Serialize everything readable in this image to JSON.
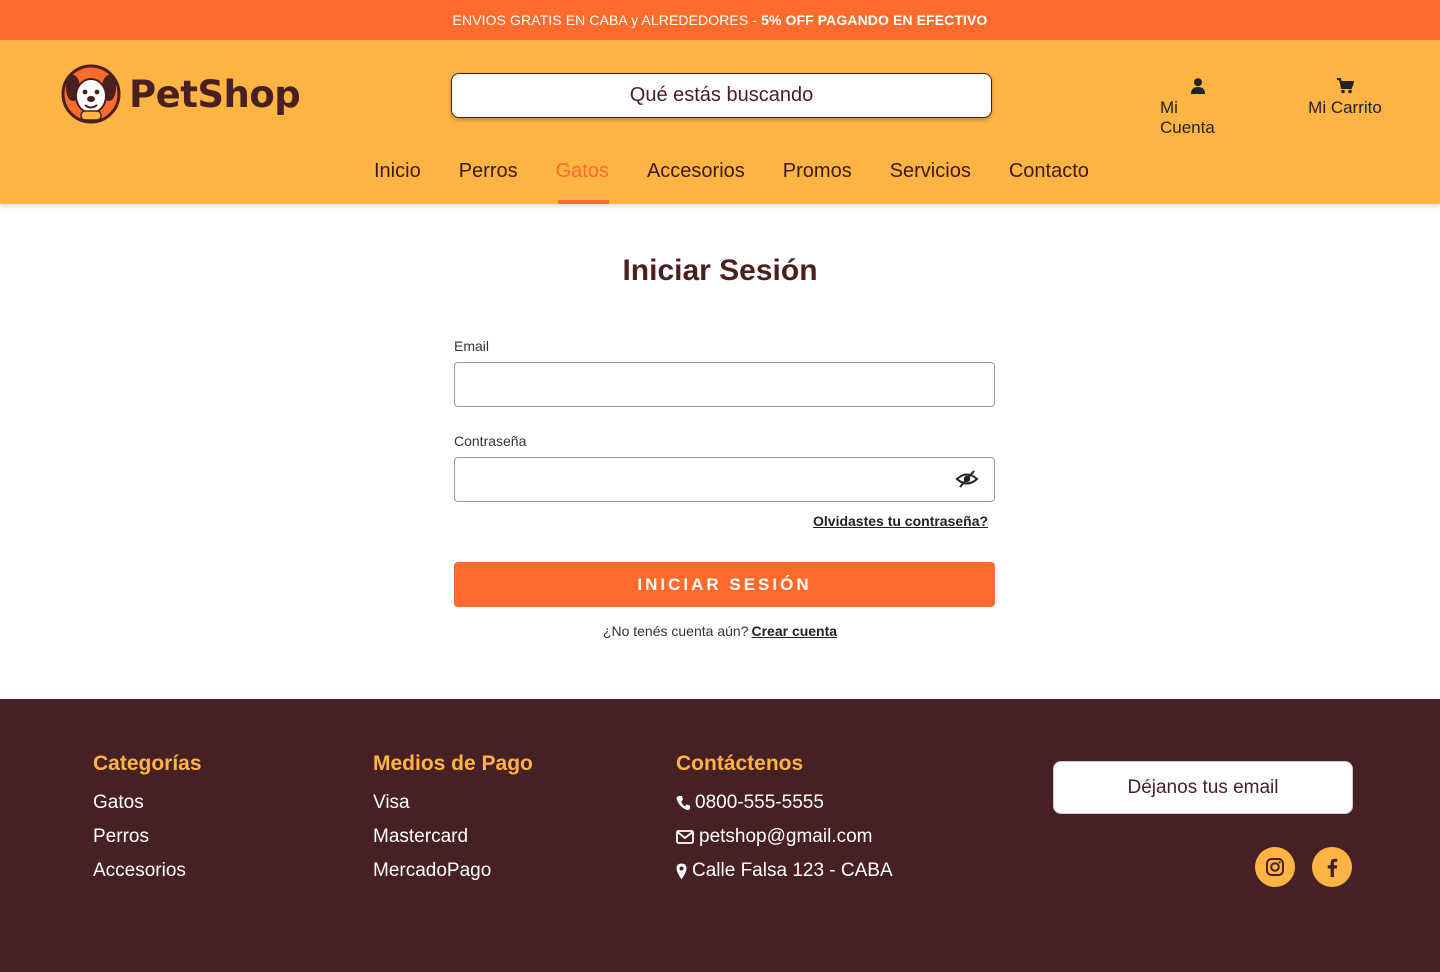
{
  "promo": {
    "text": "ENVIOS GRATIS EN CABA y ALREDEDORES -",
    "highlight": "5% OFF PAGANDO EN EFECTIVO"
  },
  "header": {
    "logo_text": "PetShop",
    "search_placeholder": "Qué estás buscando",
    "account_label": "Mi Cuenta",
    "cart_label": "Mi Carrito"
  },
  "nav": {
    "items": [
      {
        "label": "Inicio"
      },
      {
        "label": "Perros"
      },
      {
        "label": "Gatos",
        "active": true
      },
      {
        "label": "Accesorios"
      },
      {
        "label": "Promos"
      },
      {
        "label": "Servicios"
      },
      {
        "label": "Contacto"
      }
    ]
  },
  "login": {
    "title": "Iniciar Sesión",
    "email_label": "Email",
    "email_value": "",
    "password_label": "Contraseña",
    "password_value": "",
    "forgot_link": "Olvidastes tu contraseña?",
    "submit_label": "INICIAR SESIÓN",
    "signup_prompt": "¿No tenés cuenta aún?",
    "signup_link": "Crear cuenta"
  },
  "footer": {
    "categories": {
      "heading": "Categorías",
      "items": [
        "Gatos",
        "Perros",
        "Accesorios"
      ]
    },
    "payment": {
      "heading": "Medios de Pago",
      "items": [
        "Visa",
        "Mastercard",
        "MercadoPago"
      ]
    },
    "contact": {
      "heading": "Contáctenos",
      "phone": "0800-555-5555",
      "email": "petshop@gmail.com",
      "address": "Calle Falsa 123 - CABA"
    },
    "newsletter_placeholder": "Déjanos tus email",
    "social": [
      "instagram-icon",
      "facebook-icon"
    ]
  },
  "colors": {
    "accent": "#ff6b2c",
    "header_bg": "#ffb444",
    "footer_bg": "#472023",
    "text_brown": "#4a1f20"
  }
}
